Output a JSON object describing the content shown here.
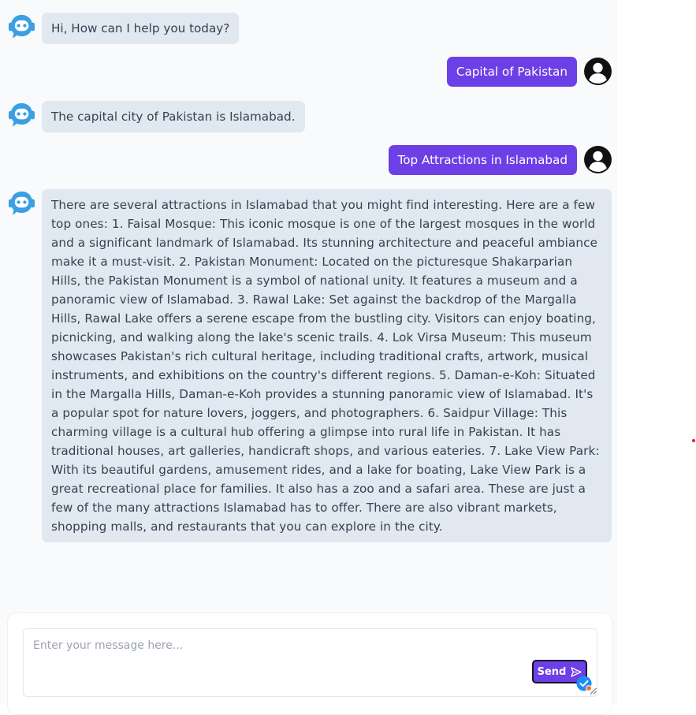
{
  "messages": {
    "m1": {
      "role": "bot",
      "text": "Hi, How can I help you today?"
    },
    "m2": {
      "role": "user",
      "text": "Capital of Pakistan"
    },
    "m3": {
      "role": "bot",
      "text": "The capital city of Pakistan is Islamabad."
    },
    "m4": {
      "role": "user",
      "text": "Top Attractions in Islamabad"
    },
    "m5": {
      "role": "bot",
      "text": "There are several attractions in Islamabad that you might find interesting. Here are a few top ones: 1. Faisal Mosque: This iconic mosque is one of the largest mosques in the world and a significant landmark of Islamabad. Its stunning architecture and peaceful ambiance make it a must-visit. 2. Pakistan Monument: Located on the picturesque Shakarparian Hills, the Pakistan Monument is a symbol of national unity. It features a museum and a panoramic view of Islamabad. 3. Rawal Lake: Set against the backdrop of the Margalla Hills, Rawal Lake offers a serene escape from the bustling city. Visitors can enjoy boating, picnicking, and walking along the lake's scenic trails. 4. Lok Virsa Museum: This museum showcases Pakistan's rich cultural heritage, including traditional crafts, artwork, musical instruments, and exhibitions on the country's different regions. 5. Daman-e-Koh: Situated in the Margalla Hills, Daman-e-Koh provides a stunning panoramic view of Islamabad. It's a popular spot for nature lovers, joggers, and photographers. 6. Saidpur Village: This charming village is a cultural hub offering a glimpse into rural life in Pakistan. It has traditional houses, art galleries, handicraft shops, and various eateries. 7. Lake View Park: With its beautiful gardens, amusement rides, and a lake for boating, Lake View Park is a great recreational place for families. It also has a zoo and a safari area. These are just a few of the many attractions Islamabad has to offer. There are also vibrant markets, shopping malls, and restaurants that you can explore in the city."
    }
  },
  "composer": {
    "value": "",
    "placeholder": "Enter your message here...",
    "send_label": "Send"
  },
  "icons": {
    "bot_avatar": "chatbot-icon",
    "user_avatar": "user-circle-icon",
    "send": "paper-plane-icon",
    "check_badge": "check-badge-icon",
    "resize": "resize-handle-icon"
  },
  "colors": {
    "accent": "#6d3fe6",
    "bot_bubble": "#e2e8f0",
    "bot_icon": "#3b9fe3",
    "panel_background": "#f8fafc",
    "page_background": "#ffffff"
  }
}
